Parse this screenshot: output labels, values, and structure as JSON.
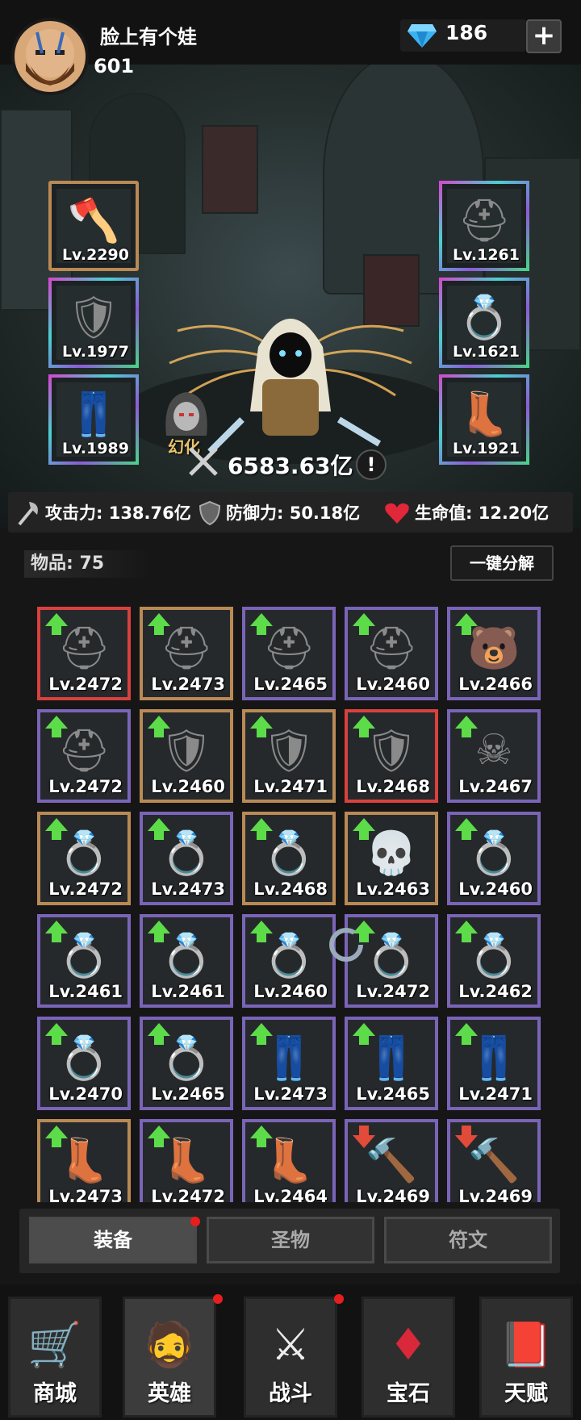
{
  "header": {
    "player_name": "脸上有个娃",
    "player_level": "601",
    "gem_count": "186",
    "plus_label": "+"
  },
  "hero": {
    "equipped_left": [
      {
        "icon": "axe-icon",
        "level": "Lv.2290",
        "rarity": "gold"
      },
      {
        "icon": "chest-armor-icon",
        "level": "Lv.1977",
        "rarity": "rainbow"
      },
      {
        "icon": "leg-armor-icon",
        "level": "Lv.1989",
        "rarity": "rainbow"
      }
    ],
    "equipped_right": [
      {
        "icon": "helmet-icon",
        "level": "Lv.1261",
        "rarity": "rainbow"
      },
      {
        "icon": "ring-icon",
        "level": "Lv.1621",
        "rarity": "rainbow"
      },
      {
        "icon": "boots-icon",
        "level": "Lv.1921",
        "rarity": "rainbow"
      }
    ],
    "transform_label": "幻化",
    "combat_power": "6583.63亿",
    "info_label": "!"
  },
  "stats": {
    "attack": "攻击力: 138.76亿",
    "defense": "防御力: 50.18亿",
    "hp": "生命值: 12.20亿"
  },
  "inventory": {
    "items_label": "物品: 75",
    "decompose_label": "一键分解",
    "items": [
      {
        "icon": "horned-helmet-icon",
        "level": "Lv.2472",
        "rarity": "red",
        "arrow": "up"
      },
      {
        "icon": "winged-helmet-icon",
        "level": "Lv.2473",
        "rarity": "gold",
        "arrow": "up"
      },
      {
        "icon": "winged-helmet-icon",
        "level": "Lv.2465",
        "rarity": "purple",
        "arrow": "up"
      },
      {
        "icon": "horned-helmet-icon",
        "level": "Lv.2460",
        "rarity": "purple",
        "arrow": "up"
      },
      {
        "icon": "bear-helmet-icon",
        "level": "Lv.2466",
        "rarity": "purple",
        "arrow": "up"
      },
      {
        "icon": "horned-helmet-icon",
        "level": "Lv.2472",
        "rarity": "purple",
        "arrow": "up"
      },
      {
        "icon": "chest-armor-icon",
        "level": "Lv.2460",
        "rarity": "gold",
        "arrow": "up"
      },
      {
        "icon": "chest-armor-icon",
        "level": "Lv.2471",
        "rarity": "gold",
        "arrow": "up"
      },
      {
        "icon": "chest-armor-icon",
        "level": "Lv.2468",
        "rarity": "red",
        "arrow": "up"
      },
      {
        "icon": "skull-armor-icon",
        "level": "Lv.2467",
        "rarity": "purple",
        "arrow": "up"
      },
      {
        "icon": "ring-icon",
        "level": "Lv.2472",
        "rarity": "gold",
        "arrow": "up"
      },
      {
        "icon": "ring-icon",
        "level": "Lv.2473",
        "rarity": "purple",
        "arrow": "up"
      },
      {
        "icon": "ring-icon",
        "level": "Lv.2468",
        "rarity": "gold",
        "arrow": "up"
      },
      {
        "icon": "skull-ring-icon",
        "level": "Lv.2463",
        "rarity": "gold",
        "arrow": "up"
      },
      {
        "icon": "ring-icon",
        "level": "Lv.2460",
        "rarity": "purple",
        "arrow": "up"
      },
      {
        "icon": "ring-icon",
        "level": "Lv.2461",
        "rarity": "purple",
        "arrow": "up"
      },
      {
        "icon": "ring-icon",
        "level": "Lv.2461",
        "rarity": "purple",
        "arrow": "up"
      },
      {
        "icon": "ring-icon",
        "level": "Lv.2460",
        "rarity": "purple",
        "arrow": "up"
      },
      {
        "icon": "ring-icon",
        "level": "Lv.2472",
        "rarity": "purple",
        "arrow": "up"
      },
      {
        "icon": "gem-ring-icon",
        "level": "Lv.2462",
        "rarity": "purple",
        "arrow": "up"
      },
      {
        "icon": "gem-ring-icon",
        "level": "Lv.2470",
        "rarity": "purple",
        "arrow": "up"
      },
      {
        "icon": "ring-icon",
        "level": "Lv.2465",
        "rarity": "purple",
        "arrow": "up"
      },
      {
        "icon": "leg-armor-icon",
        "level": "Lv.2473",
        "rarity": "purple",
        "arrow": "up"
      },
      {
        "icon": "leg-armor-icon",
        "level": "Lv.2465",
        "rarity": "purple",
        "arrow": "up"
      },
      {
        "icon": "leg-armor-icon",
        "level": "Lv.2471",
        "rarity": "purple",
        "arrow": "up"
      },
      {
        "icon": "boots-icon",
        "level": "Lv.2473",
        "rarity": "gold",
        "arrow": "up"
      },
      {
        "icon": "boots-icon",
        "level": "Lv.2472",
        "rarity": "purple",
        "arrow": "up"
      },
      {
        "icon": "boots-icon",
        "level": "Lv.2464",
        "rarity": "purple",
        "arrow": "up"
      },
      {
        "icon": "hammer-icon",
        "level": "Lv.2469",
        "rarity": "purple",
        "arrow": "down"
      },
      {
        "icon": "hammer-icon",
        "level": "Lv.2469",
        "rarity": "purple",
        "arrow": "down"
      }
    ]
  },
  "tabs": [
    {
      "label": "装备",
      "active": true,
      "badge": true
    },
    {
      "label": "圣物",
      "active": false,
      "badge": false
    },
    {
      "label": "符文",
      "active": false,
      "badge": false
    }
  ],
  "nav": [
    {
      "icon": "shop-cart-icon",
      "label": "商城",
      "active": false,
      "badge": false
    },
    {
      "icon": "hero-portrait-icon",
      "label": "英雄",
      "active": true,
      "badge": true
    },
    {
      "icon": "crossed-axes-icon",
      "label": "战斗",
      "active": false,
      "badge": true
    },
    {
      "icon": "red-gem-icon",
      "label": "宝石",
      "active": false,
      "badge": false
    },
    {
      "icon": "skull-book-icon",
      "label": "天赋",
      "active": false,
      "badge": false
    }
  ],
  "colors": {
    "gold_border": "#b98a55",
    "purple_border": "#7a64b8",
    "red_border": "#d8413e",
    "upgrade_arrow": "#5ddc4a",
    "downgrade_arrow": "#e24a3a",
    "badge": "#e81e1e"
  }
}
